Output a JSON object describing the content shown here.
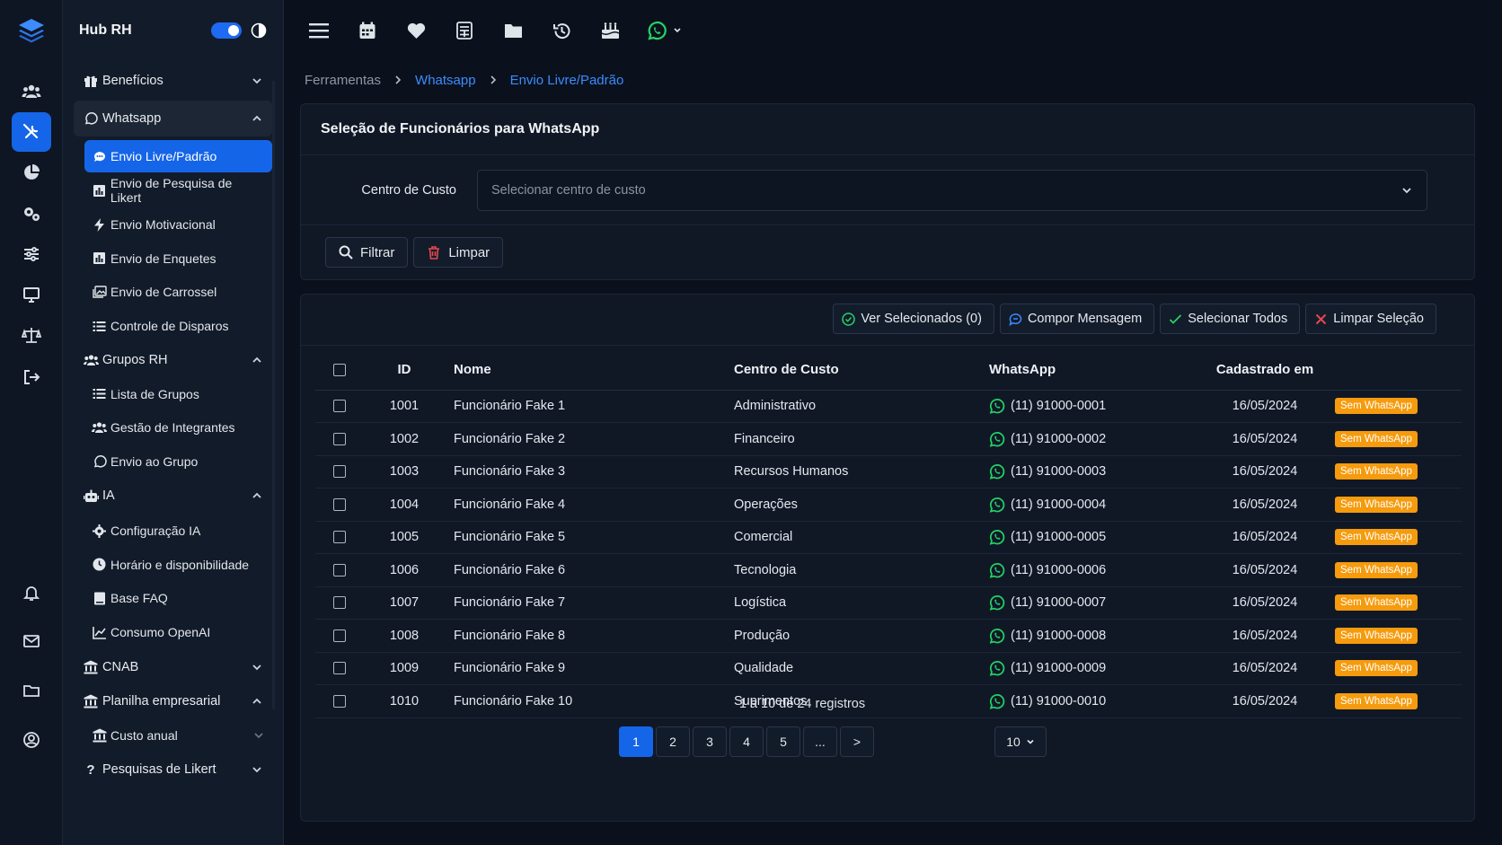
{
  "app": {
    "title": "Hub RH"
  },
  "sidebar": {
    "groups": [
      {
        "label": "Benefícios"
      },
      {
        "label": "Whatsapp",
        "items": [
          "Envio Livre/Padrão",
          "Envio de Pesquisa de Likert",
          "Envio Motivacional",
          "Envio de Enquetes",
          "Envio de Carrossel",
          "Controle de Disparos"
        ]
      },
      {
        "label": "Grupos RH",
        "items": [
          "Lista de Grupos",
          "Gestão de Integrantes",
          "Envio ao Grupo"
        ]
      },
      {
        "label": "IA",
        "items": [
          "Configuração IA",
          "Horário e disponibilidade",
          "Base FAQ",
          "Consumo OpenAI"
        ]
      },
      {
        "label": "CNAB"
      },
      {
        "label": "Planilha empresarial",
        "items": [
          "Custo anual"
        ]
      },
      {
        "label": "Pesquisas de Likert"
      }
    ]
  },
  "breadcrumb": [
    "Ferramentas",
    "Whatsapp",
    "Envio Livre/Padrão"
  ],
  "panel": {
    "title": "Seleção de Funcionários para WhatsApp",
    "cost_center_label": "Centro de Custo",
    "cost_center_placeholder": "Selecionar centro de custo",
    "filter_label": "Filtrar",
    "clear_label": "Limpar"
  },
  "actions": {
    "view_selected": "Ver Selecionados (0)",
    "compose": "Compor Mensagem",
    "select_all": "Selecionar Todos",
    "clear_selection": "Limpar Seleção"
  },
  "table": {
    "headers": [
      "ID",
      "Nome",
      "Centro de Custo",
      "WhatsApp",
      "Cadastrado em"
    ],
    "rows": [
      {
        "id": "1001",
        "nome": "Funcionário Fake 1",
        "cc": "Administrativo",
        "wa": "(11) 91000-0001",
        "date": "16/05/2024",
        "status": "Sem WhatsApp"
      },
      {
        "id": "1002",
        "nome": "Funcionário Fake 2",
        "cc": "Financeiro",
        "wa": "(11) 91000-0002",
        "date": "16/05/2024",
        "status": "Sem WhatsApp"
      },
      {
        "id": "1003",
        "nome": "Funcionário Fake 3",
        "cc": "Recursos Humanos",
        "wa": "(11) 91000-0003",
        "date": "16/05/2024",
        "status": "Sem WhatsApp"
      },
      {
        "id": "1004",
        "nome": "Funcionário Fake 4",
        "cc": "Operações",
        "wa": "(11) 91000-0004",
        "date": "16/05/2024",
        "status": "Sem WhatsApp"
      },
      {
        "id": "1005",
        "nome": "Funcionário Fake 5",
        "cc": "Comercial",
        "wa": "(11) 91000-0005",
        "date": "16/05/2024",
        "status": "Sem WhatsApp"
      },
      {
        "id": "1006",
        "nome": "Funcionário Fake 6",
        "cc": "Tecnologia",
        "wa": "(11) 91000-0006",
        "date": "16/05/2024",
        "status": "Sem WhatsApp"
      },
      {
        "id": "1007",
        "nome": "Funcionário Fake 7",
        "cc": "Logística",
        "wa": "(11) 91000-0007",
        "date": "16/05/2024",
        "status": "Sem WhatsApp"
      },
      {
        "id": "1008",
        "nome": "Funcionário Fake 8",
        "cc": "Produção",
        "wa": "(11) 91000-0008",
        "date": "16/05/2024",
        "status": "Sem WhatsApp"
      },
      {
        "id": "1009",
        "nome": "Funcionário Fake 9",
        "cc": "Qualidade",
        "wa": "(11) 91000-0009",
        "date": "16/05/2024",
        "status": "Sem WhatsApp"
      },
      {
        "id": "1010",
        "nome": "Funcionário Fake 10",
        "cc": "Suprimentos",
        "wa": "(11) 91000-0010",
        "date": "16/05/2024",
        "status": "Sem WhatsApp"
      }
    ]
  },
  "pagination": {
    "info": "1 a 10 de 24 registros",
    "pages": [
      "1",
      "2",
      "3",
      "4",
      "5",
      "...",
      ">"
    ],
    "per_page": "10"
  },
  "colors": {
    "accent": "#1565e8",
    "whatsapp": "#25d366",
    "badge": "#f59b0d"
  }
}
